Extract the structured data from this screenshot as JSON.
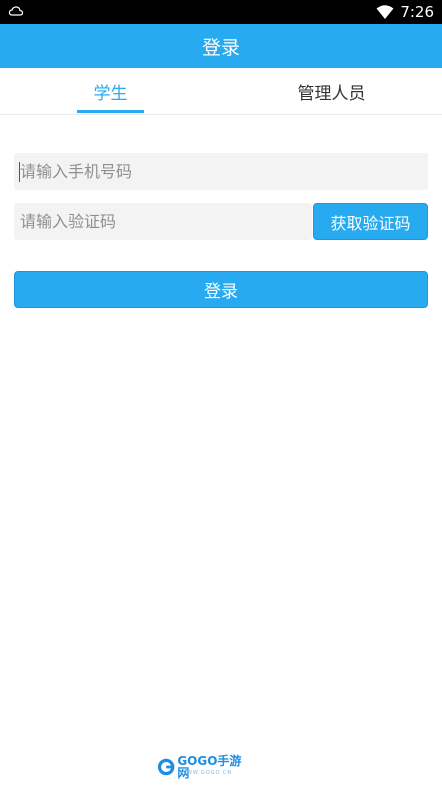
{
  "status_bar": {
    "time": "7:26",
    "left_icon": "cloud-notification-icon",
    "wifi_icon": "wifi-icon"
  },
  "header": {
    "title": "登录"
  },
  "tabs": [
    {
      "label": "学生",
      "active": true
    },
    {
      "label": "管理人员",
      "active": false
    }
  ],
  "form": {
    "phone_placeholder": "请输入手机号码",
    "phone_value": "",
    "code_placeholder": "请输入验证码",
    "code_value": "",
    "get_code_label": "获取验证码",
    "login_label": "登录"
  },
  "watermark": {
    "logo_icon": "gogo-logo-icon",
    "text": "GOGO手游网",
    "subtext": "WWW.GOGO.CN"
  },
  "colors": {
    "accent": "#27aaf0",
    "input_bg": "#f3f3f3",
    "status_bar": "#000000"
  }
}
